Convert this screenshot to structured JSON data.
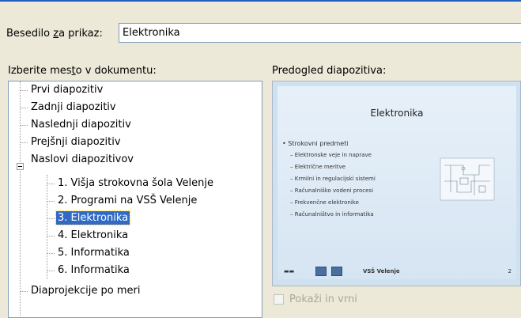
{
  "display_text": {
    "label_before": "Besedilo ",
    "label_underlined": "z",
    "label_after": "a prikaz:",
    "value": "Elektronika"
  },
  "place": {
    "label_before": "Izberite mes",
    "label_underlined": "t",
    "label_after": "o v dokumentu:",
    "items": [
      "Prvi diapozitiv",
      "Zadnji diapozitiv",
      "Naslednji diapozitiv",
      "Prejšnji diapozitiv",
      "Naslovi diapozitivov",
      "1. Višja strokovna šola Velenje",
      "2. Programi na VSŠ Velenje",
      "3. Elektronika",
      "4. Elektronika",
      "5. Informatika",
      "6. Informatika",
      "Diaprojekcije po meri"
    ],
    "selected": "3. Elektronika"
  },
  "preview": {
    "label": "Predogled diapozitiva:",
    "slide": {
      "title": "Elektronika",
      "bullet": "Strokovni predmeti",
      "subitems": [
        "Elektronske veje in naprave",
        "Električne meritve",
        "Krmilni in regulacijski sistemi",
        "Računalniško vodeni procesi",
        "Frekvenčne elektronike",
        "Računalništvo in informatika"
      ],
      "footer": "VSŠ Velenje",
      "page": "2"
    }
  },
  "show_and_return": {
    "label": "Pokaži in vrni",
    "checked": false,
    "enabled": false
  },
  "colors": {
    "dialog_bg": "#ece9d8",
    "selection": "#316ac5",
    "input_border": "#7f9db9",
    "disabled_text": "#aca899"
  }
}
